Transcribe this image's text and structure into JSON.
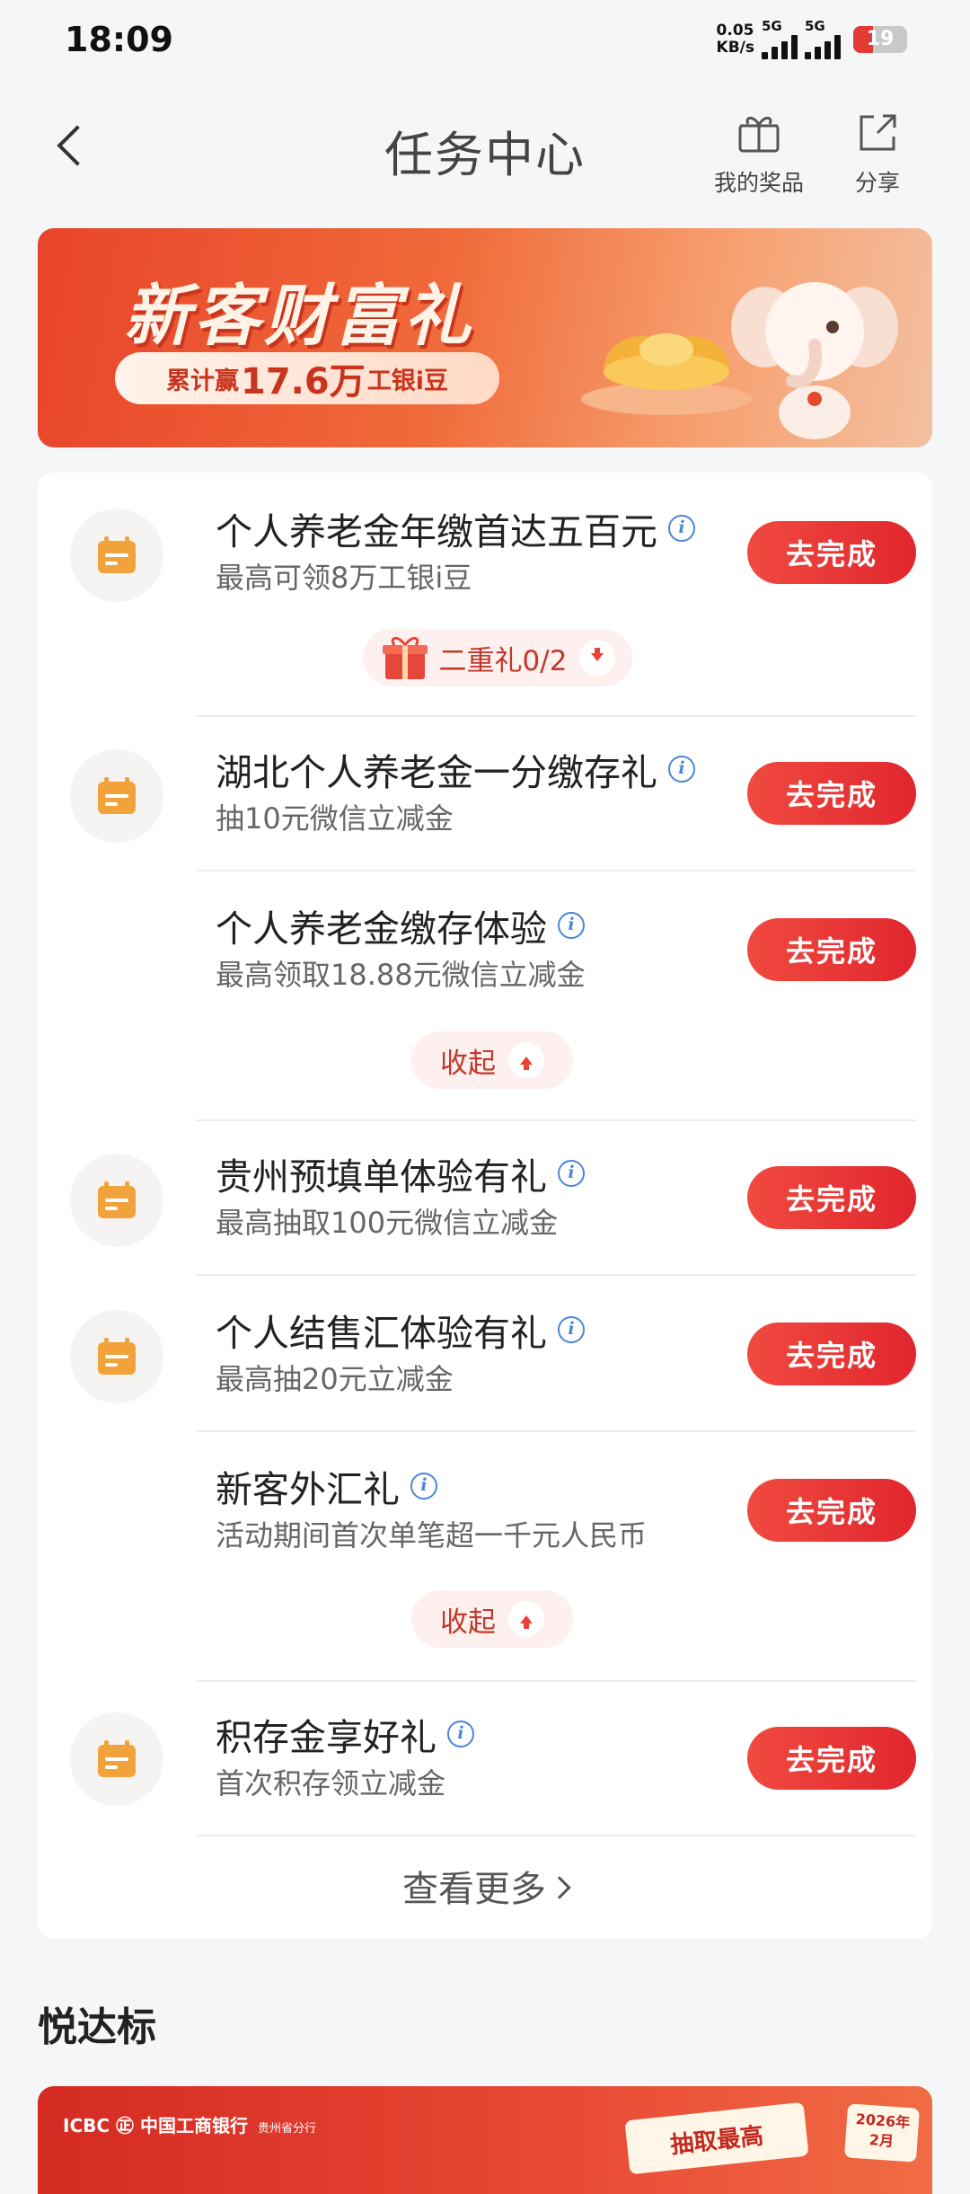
{
  "status_bar": {
    "time": "18:09",
    "net_speed_value": "0.05",
    "net_speed_unit": "KB/s",
    "sim1_tag": "5G",
    "sim2_tag": "5G",
    "battery": "19"
  },
  "header": {
    "title": "任务中心",
    "prize_label": "我的奖品",
    "share_label": "分享"
  },
  "banner": {
    "title": "新客财富礼",
    "pill_prefix": "累计赢",
    "pill_amount": "17.6万",
    "pill_suffix": "工银i豆"
  },
  "tasks": [
    {
      "title": "个人养老金年缴首达五百元",
      "subtitle": "最高可领8万工银i豆",
      "button": "去完成"
    },
    {
      "title": "湖北个人养老金一分缴存礼",
      "subtitle": "抽10元微信立减金",
      "button": "去完成"
    },
    {
      "title": "个人养老金缴存体验",
      "subtitle": "最高领取18.88元微信立减金",
      "button": "去完成"
    },
    {
      "title": "贵州预填单体验有礼",
      "subtitle": "最高抽取100元微信立减金",
      "button": "去完成"
    },
    {
      "title": "个人结售汇体验有礼",
      "subtitle": "最高抽20元立减金",
      "button": "去完成"
    },
    {
      "title": "新客外汇礼",
      "subtitle": "活动期间首次单笔超一千元人民币",
      "button": "去完成"
    },
    {
      "title": "积存金享好礼",
      "subtitle": "首次积存领立减金",
      "button": "去完成"
    }
  ],
  "toggles": {
    "second_gift": "二重礼0/2",
    "collapse_1": "收起",
    "collapse_2": "收起"
  },
  "see_more": "查看更多",
  "section": {
    "title": "悦达标"
  },
  "bottom_banner": {
    "logo_text": "ICBC ㊣ 中国工商银行",
    "branch": "贵州省分行",
    "tag": "抽取最高",
    "date_line1": "2026年",
    "date_line2": "2月"
  },
  "colors": {
    "accent_red": "#e1262d",
    "calendar_orange": "#f2a23a",
    "info_blue": "#4a86d8"
  }
}
